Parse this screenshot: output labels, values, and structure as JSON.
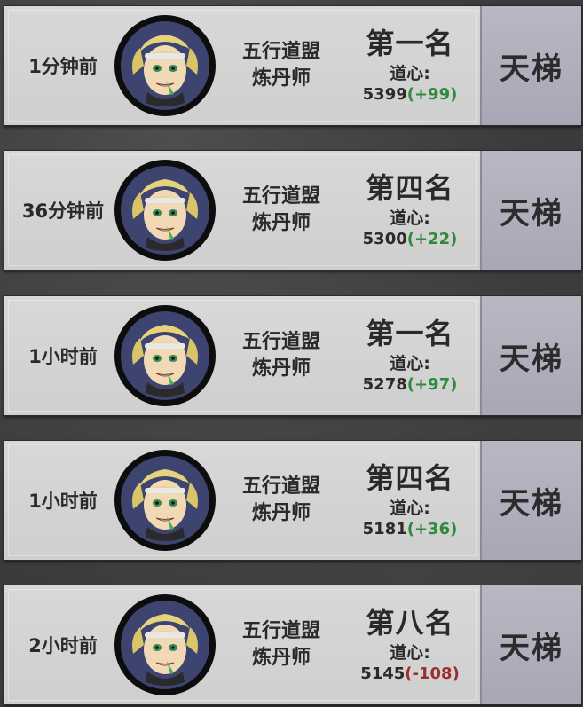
{
  "records": [
    {
      "time": "1分钟前",
      "sect": "五行道盟",
      "role": "炼丹师",
      "rank": "第一名",
      "stat_label": "道心:",
      "score": "5399",
      "delta": "(+99)",
      "delta_dir": "up",
      "mode": "天梯"
    },
    {
      "time": "36分钟前",
      "sect": "五行道盟",
      "role": "炼丹师",
      "rank": "第四名",
      "stat_label": "道心:",
      "score": "5300",
      "delta": "(+22)",
      "delta_dir": "up",
      "mode": "天梯"
    },
    {
      "time": "1小时前",
      "sect": "五行道盟",
      "role": "炼丹师",
      "rank": "第一名",
      "stat_label": "道心:",
      "score": "5278",
      "delta": "(+97)",
      "delta_dir": "up",
      "mode": "天梯"
    },
    {
      "time": "1小时前",
      "sect": "五行道盟",
      "role": "炼丹师",
      "rank": "第四名",
      "stat_label": "道心:",
      "score": "5181",
      "delta": "(+36)",
      "delta_dir": "up",
      "mode": "天梯"
    },
    {
      "time": "2小时前",
      "sect": "五行道盟",
      "role": "炼丹师",
      "rank": "第八名",
      "stat_label": "道心:",
      "score": "5145",
      "delta": "(-108)",
      "delta_dir": "down",
      "mode": "天梯"
    }
  ],
  "colors": {
    "delta_up": "#2e8a3a",
    "delta_down": "#9a2f2f",
    "card": "#d4d4d4",
    "side": "#b1afbd"
  },
  "icons": {
    "avatar": "blonde-character-portrait-icon"
  }
}
